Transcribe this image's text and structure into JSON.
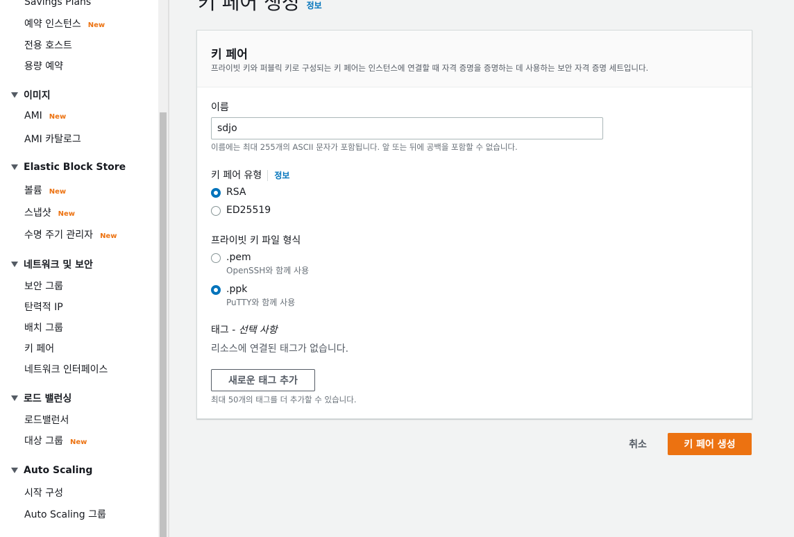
{
  "sidebar": {
    "items": [
      {
        "label": "Savings Plans",
        "new": ""
      },
      {
        "label": "예약 인스턴스",
        "new": "New"
      },
      {
        "label": "전용 호스트",
        "new": ""
      },
      {
        "label": "용량 예약",
        "new": ""
      }
    ],
    "sections": [
      {
        "title": "이미지",
        "items": [
          {
            "label": "AMI",
            "new": "New"
          },
          {
            "label": "AMI 카탈로그",
            "new": ""
          }
        ]
      },
      {
        "title": "Elastic Block Store",
        "items": [
          {
            "label": "볼륨",
            "new": "New"
          },
          {
            "label": "스냅샷",
            "new": "New"
          },
          {
            "label": "수명 주기 관리자",
            "new": "New"
          }
        ]
      },
      {
        "title": "네트워크 및 보안",
        "items": [
          {
            "label": "보안 그룹",
            "new": ""
          },
          {
            "label": "탄력적 IP",
            "new": ""
          },
          {
            "label": "배치 그룹",
            "new": ""
          },
          {
            "label": "키 페어",
            "new": ""
          },
          {
            "label": "네트워크 인터페이스",
            "new": ""
          }
        ]
      },
      {
        "title": "로드 밸런싱",
        "items": [
          {
            "label": "로드밸런서",
            "new": ""
          },
          {
            "label": "대상 그룹",
            "new": "New"
          }
        ]
      },
      {
        "title": "Auto Scaling",
        "items": [
          {
            "label": "시작 구성",
            "new": ""
          },
          {
            "label": "Auto Scaling 그룹",
            "new": ""
          }
        ]
      }
    ]
  },
  "page": {
    "title": "키 페어 생성",
    "info": "정보"
  },
  "panel": {
    "title": "키 페어",
    "description": "프라이빗 키와 퍼블릭 키로 구성되는 키 페어는 인스턴스에 연결할 때 자격 증명을 증명하는 데 사용하는 보안 자격 증명 세트입니다.",
    "name_label": "이름",
    "name_value": "sdjo",
    "name_hint": "이름에는 최대 255개의 ASCII 문자가 포함됩니다. 앞 또는 뒤에 공백을 포함할 수 없습니다.",
    "type_label": "키 페어 유형",
    "type_info": "정보",
    "type_options": [
      {
        "label": "RSA",
        "checked": true
      },
      {
        "label": "ED25519",
        "checked": false
      }
    ],
    "format_label": "프라이빗 키 파일 형식",
    "format_options": [
      {
        "label": ".pem",
        "sub": "OpenSSH와 함께 사용",
        "checked": false
      },
      {
        "label": ".ppk",
        "sub": "PuTTY와 함께 사용",
        "checked": true
      }
    ],
    "tags_label": "태그 -",
    "tags_optional": "선택 사항",
    "tags_empty": "리소스에 연결된 태그가 없습니다.",
    "add_tag_button": "새로운 태그 추가",
    "tags_hint": "최대 50개의 태그를 더 추가할 수 있습니다."
  },
  "footer": {
    "cancel": "취소",
    "create": "키 페어 생성"
  },
  "colors": {
    "accent": "#ec7211",
    "link": "#0073bb",
    "radio_checked": "#0073bb"
  }
}
